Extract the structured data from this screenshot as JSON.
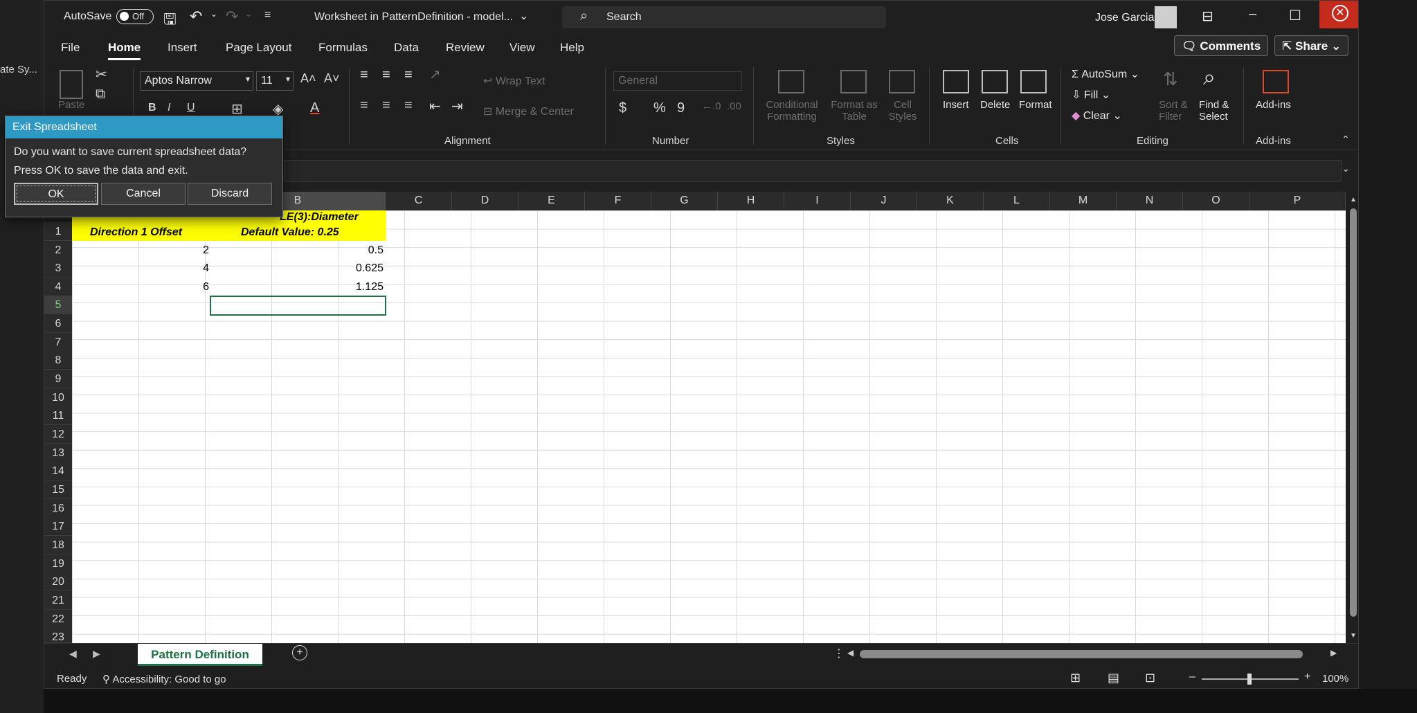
{
  "background_app": {
    "sidebar_text": "ate Sy..."
  },
  "titlebar": {
    "autosave_label": "AutoSave",
    "autosave_state": "Off",
    "doc_title": "Worksheet in PatternDefinition - model...",
    "search_label": "Search",
    "user_name": "Jose Garcia"
  },
  "menu": {
    "tabs": [
      "File",
      "Home",
      "Insert",
      "Page Layout",
      "Formulas",
      "Data",
      "Review",
      "View",
      "Help"
    ],
    "active": "Home",
    "comments_label": "Comments",
    "share_label": "Share"
  },
  "ribbon": {
    "paste_label": "Paste",
    "font_name": "Aptos Narrow",
    "font_size": "11",
    "wrap_text": "Wrap Text",
    "merge_center": "Merge & Center",
    "number_format": "General",
    "conditional_formatting": [
      "Conditional",
      "Formatting"
    ],
    "format_as_table": [
      "Format as",
      "Table"
    ],
    "cell_styles": [
      "Cell",
      "Styles"
    ],
    "insert": "Insert",
    "delete": "Delete",
    "format": "Format",
    "autosum": "AutoSum",
    "fill": "Fill",
    "clear": "Clear",
    "sort_filter": [
      "Sort &",
      "Filter"
    ],
    "find_select": [
      "Find &",
      "Select"
    ],
    "addins": "Add-ins",
    "groups": {
      "alignment": "Alignment",
      "number": "Number",
      "styles": "Styles",
      "cells": "Cells",
      "editing": "Editing",
      "addins": "Add-ins"
    }
  },
  "grid": {
    "columns": [
      "B",
      "C",
      "D",
      "E",
      "F",
      "G",
      "H",
      "I",
      "J",
      "K",
      "L",
      "M",
      "N",
      "O",
      "P"
    ],
    "rows": [
      "1",
      "2",
      "3",
      "4",
      "5",
      "6",
      "7",
      "8",
      "9",
      "10",
      "11",
      "12",
      "13",
      "14",
      "15",
      "16",
      "17",
      "18",
      "19",
      "20",
      "21",
      "22",
      "23"
    ],
    "header_a": "Direction 1 Offset",
    "header_b_line1": "LE(3):Diameter",
    "header_b_line2": "Default Value:  0.25",
    "data": [
      [
        "2",
        "0.5"
      ],
      [
        "4",
        "0.625"
      ],
      [
        "6",
        "1.125"
      ]
    ]
  },
  "sheet_tab": "Pattern Definition",
  "status": {
    "ready": "Ready",
    "accessibility": "Accessibility: Good to go",
    "zoom": "100%"
  },
  "dialog": {
    "title": "Exit Spreadsheet",
    "line1": "Do you want to save current spreadsheet data?",
    "line2": "Press OK to save the data and exit.",
    "ok": "OK",
    "cancel": "Cancel",
    "discard": "Discard"
  }
}
